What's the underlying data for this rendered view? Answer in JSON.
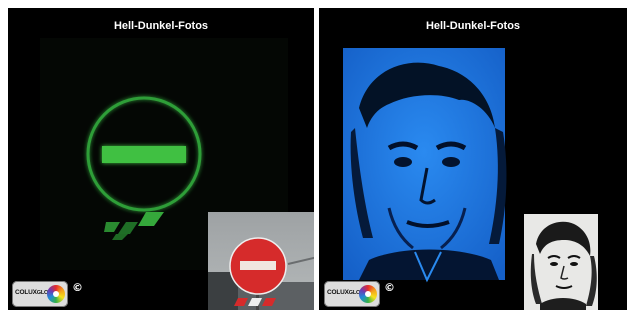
{
  "left_panel": {
    "heading": "Hell-Dunkel-Fotos",
    "logo": {
      "brand": "COLUX",
      "sub": "GLOW",
      "icon": "colux-glow-logo"
    },
    "copyright": "©",
    "glow_color": "#3bbf3b"
  },
  "right_panel": {
    "heading": "Hell-Dunkel-Fotos",
    "logo": {
      "brand": "COLUX",
      "sub": "GLOW",
      "icon": "colux-glow-logo"
    },
    "copyright": "©",
    "glow_color": "#1f7ae6"
  },
  "colors": {
    "background": "#000000",
    "sign_red": "#d62b2b",
    "glow_green": "#3bbf3b",
    "glow_blue": "#1f7ae6"
  }
}
